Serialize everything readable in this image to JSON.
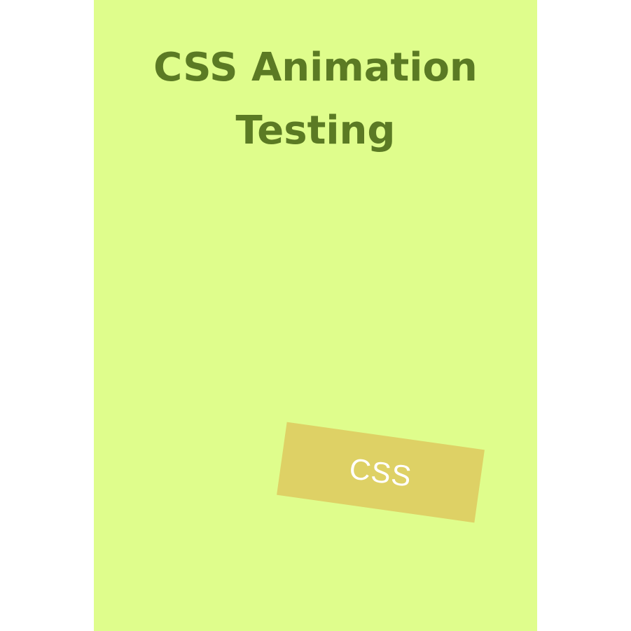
{
  "page": {
    "title_line_1": "CSS Animation",
    "title_line_2": "Testing",
    "animated_box_label": "CSS",
    "colors": {
      "background": "#dffd8c",
      "title": "#5b7a24",
      "box": "#ded165",
      "box_text": "#ffffff"
    }
  }
}
